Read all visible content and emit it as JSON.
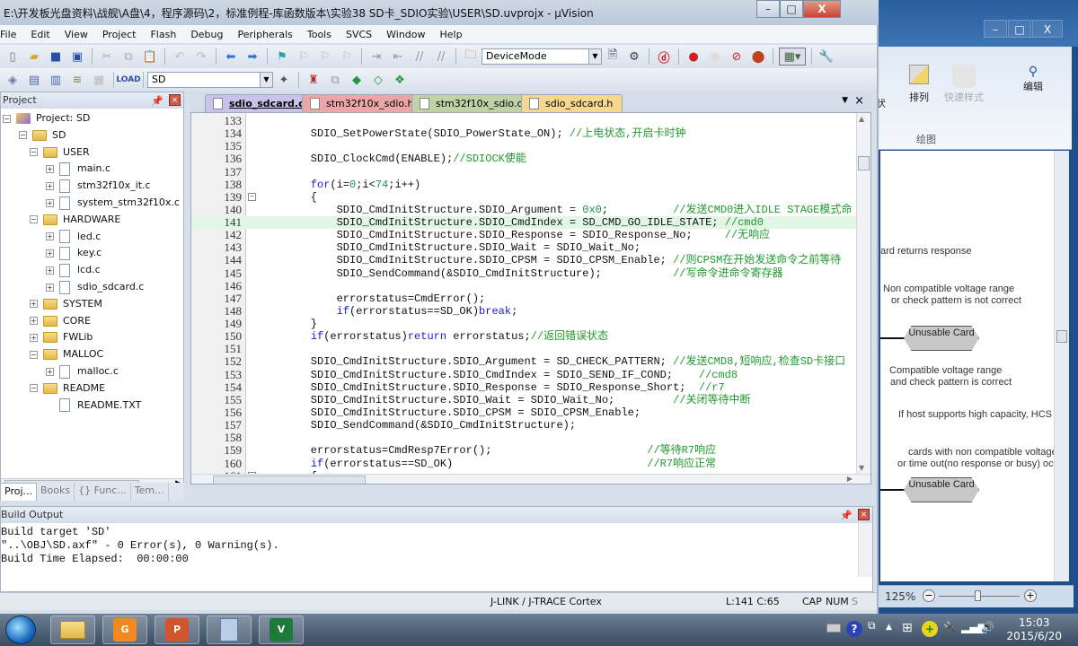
{
  "window": {
    "title": "E:\\开发板光盘资料\\战舰\\A盘\\4，程序源码\\2，标准例程-库函数版本\\实验38 SD卡_SDIO实验\\USER\\SD.uvprojx - µVision",
    "minimize": "–",
    "maximize": "□",
    "close": "X"
  },
  "menu": [
    "File",
    "Edit",
    "View",
    "Project",
    "Flash",
    "Debug",
    "Peripherals",
    "Tools",
    "SVCS",
    "Window",
    "Help"
  ],
  "toolbar": {
    "device_mode": "DeviceMode",
    "target_select": "SD"
  },
  "project_panel": {
    "title": "Project",
    "tree": [
      {
        "label": "Project: SD",
        "type": "project",
        "level": 0
      },
      {
        "label": "SD",
        "type": "target",
        "level": 1
      },
      {
        "label": "USER",
        "type": "folder",
        "level": 2,
        "expanded": true
      },
      {
        "label": "main.c",
        "type": "file",
        "level": 3
      },
      {
        "label": "stm32f10x_it.c",
        "type": "file",
        "level": 3
      },
      {
        "label": "system_stm32f10x.c",
        "type": "file",
        "level": 3
      },
      {
        "label": "HARDWARE",
        "type": "folder",
        "level": 2,
        "expanded": true
      },
      {
        "label": "led.c",
        "type": "file",
        "level": 3
      },
      {
        "label": "key.c",
        "type": "file",
        "level": 3
      },
      {
        "label": "lcd.c",
        "type": "file",
        "level": 3
      },
      {
        "label": "sdio_sdcard.c",
        "type": "file",
        "level": 3
      },
      {
        "label": "SYSTEM",
        "type": "folder",
        "level": 2,
        "expanded": false
      },
      {
        "label": "CORE",
        "type": "folder",
        "level": 2,
        "expanded": false
      },
      {
        "label": "FWLib",
        "type": "folder",
        "level": 2,
        "expanded": false
      },
      {
        "label": "MALLOC",
        "type": "folder",
        "level": 2,
        "expanded": true
      },
      {
        "label": "malloc.c",
        "type": "file",
        "level": 3
      },
      {
        "label": "README",
        "type": "folder",
        "level": 2,
        "expanded": true
      },
      {
        "label": "README.TXT",
        "type": "file",
        "level": 3
      }
    ],
    "tabs": [
      "Proj...",
      "Books",
      "{} Func...",
      "Tem..."
    ]
  },
  "editor": {
    "tabs": [
      {
        "label": "sdio_sdcard.c",
        "color": "#c9c3ea",
        "active": true
      },
      {
        "label": "stm32f10x_sdio.h",
        "color": "#eba7a7",
        "active": false
      },
      {
        "label": "stm32f10x_sdio.c",
        "color": "#bfd3a6",
        "active": false
      },
      {
        "label": "sdio_sdcard.h",
        "color": "#f5d890",
        "active": false
      }
    ],
    "current_line": 141,
    "lines": [
      {
        "n": "133",
        "code": "",
        "comment": ""
      },
      {
        "n": "134",
        "code": "    SDIO_SetPowerState(SDIO_PowerState_ON); ",
        "comment": "//上电状态,开启卡时钟"
      },
      {
        "n": "135",
        "code": "",
        "comment": ""
      },
      {
        "n": "136",
        "code": "    SDIO_ClockCmd(ENABLE);",
        "comment": "//SDIOCK使能"
      },
      {
        "n": "137",
        "code": "",
        "comment": ""
      },
      {
        "n": "138",
        "code": "    for(i=0;i<74;i++)",
        "comment": ""
      },
      {
        "n": "139",
        "code": "    {",
        "comment": "",
        "fold": "−"
      },
      {
        "n": "140",
        "code": "        SDIO_CmdInitStructure.SDIO_Argument = 0x0;          ",
        "comment": "//发送CMD0进入IDLE STAGE模式命"
      },
      {
        "n": "141",
        "code": "        SDIO_CmdInitStructure.SDIO_CmdIndex = SD_CMD_GO_IDLE_STATE; ",
        "comment": "//cmd0"
      },
      {
        "n": "142",
        "code": "        SDIO_CmdInitStructure.SDIO_Response = SDIO_Response_No;     ",
        "comment": "//无响应"
      },
      {
        "n": "143",
        "code": "        SDIO_CmdInitStructure.SDIO_Wait = SDIO_Wait_No;",
        "comment": ""
      },
      {
        "n": "144",
        "code": "        SDIO_CmdInitStructure.SDIO_CPSM = SDIO_CPSM_Enable; ",
        "comment": "//则CPSM在开始发送命令之前等待"
      },
      {
        "n": "145",
        "code": "        SDIO_SendCommand(&SDIO_CmdInitStructure);           ",
        "comment": "//写命令进命令寄存器"
      },
      {
        "n": "146",
        "code": "",
        "comment": ""
      },
      {
        "n": "147",
        "code": "        errorstatus=CmdError();",
        "comment": ""
      },
      {
        "n": "148",
        "code": "        if(errorstatus==SD_OK)break;",
        "comment": ""
      },
      {
        "n": "149",
        "code": "    }",
        "comment": ""
      },
      {
        "n": "150",
        "code": "    if(errorstatus)return errorstatus;",
        "comment": "//返回错误状态"
      },
      {
        "n": "151",
        "code": "",
        "comment": ""
      },
      {
        "n": "152",
        "code": "    SDIO_CmdInitStructure.SDIO_Argument = SD_CHECK_PATTERN; ",
        "comment": "//发送CMD8,短响应,检查SD卡接口"
      },
      {
        "n": "153",
        "code": "    SDIO_CmdInitStructure.SDIO_CmdIndex = SDIO_SEND_IF_COND;    ",
        "comment": "//cmd8"
      },
      {
        "n": "154",
        "code": "    SDIO_CmdInitStructure.SDIO_Response = SDIO_Response_Short;  ",
        "comment": "//r7"
      },
      {
        "n": "155",
        "code": "    SDIO_CmdInitStructure.SDIO_Wait = SDIO_Wait_No;         ",
        "comment": "//关闭等待中断"
      },
      {
        "n": "156",
        "code": "    SDIO_CmdInitStructure.SDIO_CPSM = SDIO_CPSM_Enable;",
        "comment": ""
      },
      {
        "n": "157",
        "code": "    SDIO_SendCommand(&SDIO_CmdInitStructure);",
        "comment": ""
      },
      {
        "n": "158",
        "code": "",
        "comment": ""
      },
      {
        "n": "159",
        "code": "    errorstatus=CmdResp7Error();                        ",
        "comment": "//等待R7响应"
      },
      {
        "n": "160",
        "code": "    if(errorstatus==SD_OK)                              ",
        "comment": "//R7响应正常"
      },
      {
        "n": "161",
        "code": "    {",
        "comment": "",
        "fold": "−"
      }
    ]
  },
  "build_output": {
    "title": "Build Output",
    "lines": [
      "Build target 'SD'",
      "\"..\\OBJ\\SD.axf\" - 0 Error(s), 0 Warning(s).",
      "Build Time Elapsed:  00:00:00"
    ]
  },
  "statusbar": {
    "debugger": "J-LINK / J-TRACE Cortex",
    "position": "L:141 C:65",
    "cap": "CAP",
    "num": "NUM",
    "scrl": "S"
  },
  "background_word": {
    "ribbon": {
      "shape_label": "状",
      "arrange": "排列",
      "quick_styles": "快速样式",
      "editing": "编辑",
      "group_drawing": "绘图"
    },
    "doc_texts": [
      "ard returns response",
      "Non   compatible voltage range",
      "or check pattern is not correct",
      "Compatible voltage range",
      "and check pattern is correct",
      "If host supports high capacity, HCS is",
      "cards with non compatible voltage ra",
      "or time    out(no response or busy) occ"
    ],
    "unusable_card": "Unusable Card",
    "zoom": "125%"
  },
  "taskbar": {
    "apps": [
      "File Explorer",
      "Foxit PDF",
      "PowerPoint",
      "Calculator",
      "µVision"
    ],
    "time": "15:03",
    "date": "2015/6/20"
  }
}
